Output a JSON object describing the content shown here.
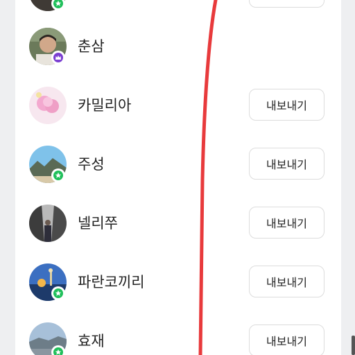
{
  "colors": {
    "annotation": "#e83a3c",
    "badge_crown": "#7b3fd1",
    "badge_star": "#1fbf5a",
    "button_border": "#dcdcdc"
  },
  "export_label": "내보내기",
  "members": [
    {
      "name": "",
      "badge": "star-icon",
      "has_export": true
    },
    {
      "name": "춘삼",
      "badge": "crown-icon",
      "has_export": false
    },
    {
      "name": "카밀리아",
      "badge": null,
      "has_export": true
    },
    {
      "name": "주성",
      "badge": "star-icon",
      "has_export": true
    },
    {
      "name": "넬리쭈",
      "badge": null,
      "has_export": true
    },
    {
      "name": "파란코끼리",
      "badge": "star-icon",
      "has_export": true
    },
    {
      "name": "효재",
      "badge": "star-icon",
      "has_export": true
    }
  ]
}
